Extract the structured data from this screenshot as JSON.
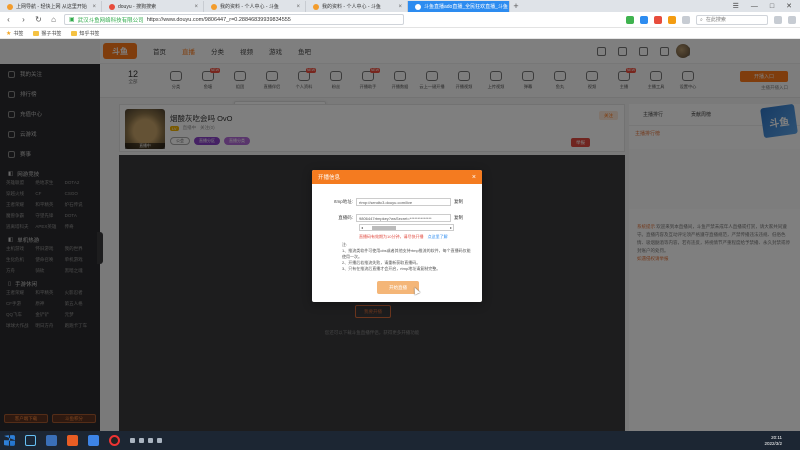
{
  "browser": {
    "tabs": [
      {
        "label": "上网导航 - 轻快上网 从这里开始"
      },
      {
        "label": "douyu - 搜狗搜索"
      },
      {
        "label": "我的资料 - 个人中心 - 斗鱼"
      },
      {
        "label": "我的资料 - 个人中心 - 斗鱼"
      },
      {
        "label": "斗鱼直播ado直播_全民狂欢直播_斗鱼"
      }
    ],
    "new_tab": "+",
    "address": {
      "site": "武汉斗鱼网络科技有限公司",
      "url": "https://www.douyu.com/9806447_r=0.28846839939834555"
    },
    "search_placeholder": "在此搜索",
    "bookmarks": [
      {
        "label": "书签"
      },
      {
        "label": "猴子书签"
      },
      {
        "label": "知乎书签"
      }
    ]
  },
  "site": {
    "logo": "斗鱼",
    "nav": [
      "首页",
      "直播",
      "分类",
      "视频",
      "游戏",
      "鱼吧"
    ]
  },
  "sidebar": {
    "items": [
      {
        "label": "我的关注"
      },
      {
        "label": "排行榜"
      },
      {
        "label": "充值中心"
      },
      {
        "label": "云游戏"
      },
      {
        "label": "赛事"
      }
    ],
    "sections": [
      {
        "title": "网游竞技",
        "items": [
          "英雄联盟",
          "绝地求生",
          "DOTA2",
          "穿越火线",
          "CF",
          "CSGO",
          "王者荣耀",
          "和平精英",
          "炉石传说",
          "魔兽争霸",
          "守望先锋",
          "DOTA",
          "逃离塔科夫",
          "APEX英雄",
          "传奇"
        ]
      },
      {
        "title": "单机热游",
        "items": [
          "主机游戏",
          "怀旧游戏",
          "我的世界",
          "生化危机",
          "使命召唤",
          "单机游戏",
          "方舟",
          "骑砍",
          "黑暗之魂"
        ]
      },
      {
        "title": "手游休闲",
        "items": [
          "王者荣耀",
          "和平精英",
          "火影忍者",
          "CF手游",
          "原神",
          "第五人格",
          "QQ飞车",
          "金铲铲",
          "元梦",
          "球球大作战",
          "明日方舟",
          "跑跑卡丁车"
        ]
      }
    ],
    "bottom_buttons": [
      "客户端下载",
      "斗鱼积分"
    ]
  },
  "categories": {
    "count": "12",
    "count_label": "全部",
    "items": [
      {
        "label": "分类"
      },
      {
        "label": "鱼塘",
        "badge": "NEW"
      },
      {
        "label": "组团"
      },
      {
        "label": "直播伴侣"
      },
      {
        "label": "个人资料",
        "badge": "NEW"
      },
      {
        "label": "粉丝"
      },
      {
        "label": "开播助手",
        "badge": "NEW"
      },
      {
        "label": "开播数据"
      },
      {
        "label": "云上一键开播"
      },
      {
        "label": "开播视频"
      },
      {
        "label": "上传视频"
      },
      {
        "label": "弹幕"
      },
      {
        "label": "鱼丸"
      },
      {
        "label": "视频"
      },
      {
        "label": "主播",
        "badge": "NEW"
      },
      {
        "label": "主播工具"
      },
      {
        "label": "设置中心"
      },
      {
        "label": "更多"
      }
    ],
    "button": "开播入口",
    "sub": "主播开播入口"
  },
  "tooltip": {
    "text": "关于设置直播相关信息，可在开播后直接前往主播中心进行管理"
  },
  "room": {
    "title": "烟酸灰吃会吗 OvO",
    "status": "直播中",
    "fans": "关注(0)",
    "level": "LV",
    "tags": [
      "公会",
      "直播分区",
      "直播分类"
    ],
    "follow": "关注",
    "report": "举报",
    "thumb_badge": "直播中"
  },
  "video": {
    "start_button": "我要开播",
    "hint": "您还可以下载斗鱼直播伴侣，获得更多开播功能"
  },
  "right_panel": {
    "tabs": [
      "主播排行",
      "贡献周榜"
    ],
    "row1": "主播排行榜",
    "chat_title": "系统提示",
    "chat": "欢迎来到本直播间，斗鱼严禁未成年人直播或打赏，请大家共同遵守。直播内容及互动评论须严格遵守直播规范，严禁传播违法违规、低俗色情、吸烟酗酒等内容，若有违反，将视情节严重程度给予禁播、永久封禁或停封账户的处罚。",
    "chat_link": "如遇侵权请举报",
    "qr": "斗鱼"
  },
  "modal": {
    "title": "开播信息",
    "close": "×",
    "rtmp_label": "rtmp地址:",
    "rtmp_value": "rtmp://sendtc3.douyu.com/live",
    "key_label": "直播码:",
    "key_value": "9806447rtmpkey?wsSecret=**************",
    "copy": "复制",
    "warning": "直播码有效期为10分钟，请尽快开播",
    "warning_link": "点这里了解",
    "notes_title": "注:",
    "notes": [
      "1、推流类软件可使用obs或者其他支持rtmp推流的软件，每个直播码仅能使用一次。",
      "2、开播后若推流失败，请重新获取直播码。",
      "3、只有在推流后直播才会开启，rtmp地址请复制完整。"
    ],
    "button": "开始直播"
  },
  "taskbar": {
    "time": "20:11",
    "date": "2022/3/2"
  }
}
